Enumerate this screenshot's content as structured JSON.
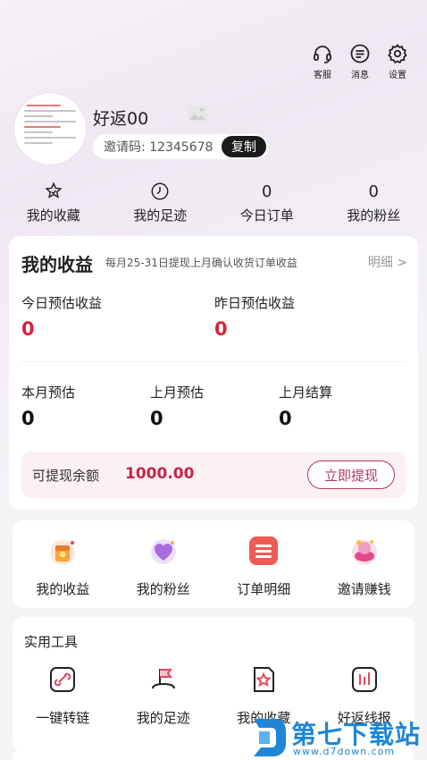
{
  "top_actions": [
    {
      "label": "客服",
      "icon": "headset-icon"
    },
    {
      "label": "消息",
      "icon": "message-icon"
    },
    {
      "label": "设置",
      "icon": "gear-icon"
    }
  ],
  "profile": {
    "username": "好返00",
    "invite_label": "邀请码: 12345678",
    "copy_label": "复制"
  },
  "stats": [
    {
      "top": "",
      "icon": "star-badge-icon",
      "label": "我的收藏"
    },
    {
      "top": "",
      "icon": "clock-icon",
      "label": "我的足迹"
    },
    {
      "top": "0",
      "label": "今日订单"
    },
    {
      "top": "0",
      "label": "我的粉丝"
    }
  ],
  "earnings": {
    "title": "我的收益",
    "subtitle": "每月25-31日提现上月确认收货订单收益",
    "detail_link": "明细 >",
    "today_label": "今日预估收益",
    "today_value": "0",
    "yesterday_label": "昨日预估收益",
    "yesterday_value": "0",
    "month_label": "本月预估",
    "month_value": "0",
    "last_month_label": "上月预估",
    "last_month_value": "0",
    "settled_label": "上月结算",
    "settled_value": "0",
    "withdraw_label": "可提现余额",
    "withdraw_amount": "1000.00",
    "withdraw_button": "立即提现"
  },
  "quick_menu": [
    {
      "label": "我的收益",
      "icon": "earnings-gift-icon"
    },
    {
      "label": "我的粉丝",
      "icon": "fans-heart-icon"
    },
    {
      "label": "订单明细",
      "icon": "order-list-icon"
    },
    {
      "label": "邀请赚钱",
      "icon": "invite-money-icon"
    }
  ],
  "tools": {
    "title": "实用工具",
    "items": [
      {
        "label": "一键转链",
        "icon": "link-convert-icon"
      },
      {
        "label": "我的足迹",
        "icon": "footprint-flag-icon"
      },
      {
        "label": "我的收藏",
        "icon": "favorite-star-icon"
      },
      {
        "label": "好返线报",
        "icon": "report-chart-icon"
      }
    ]
  },
  "watermark": {
    "text": "第七下载站",
    "url": "www.d7down.com"
  },
  "colors": {
    "accent_red": "#d4253c",
    "brand_pink": "#b8365a",
    "watermark_blue": "#1e86d6"
  }
}
